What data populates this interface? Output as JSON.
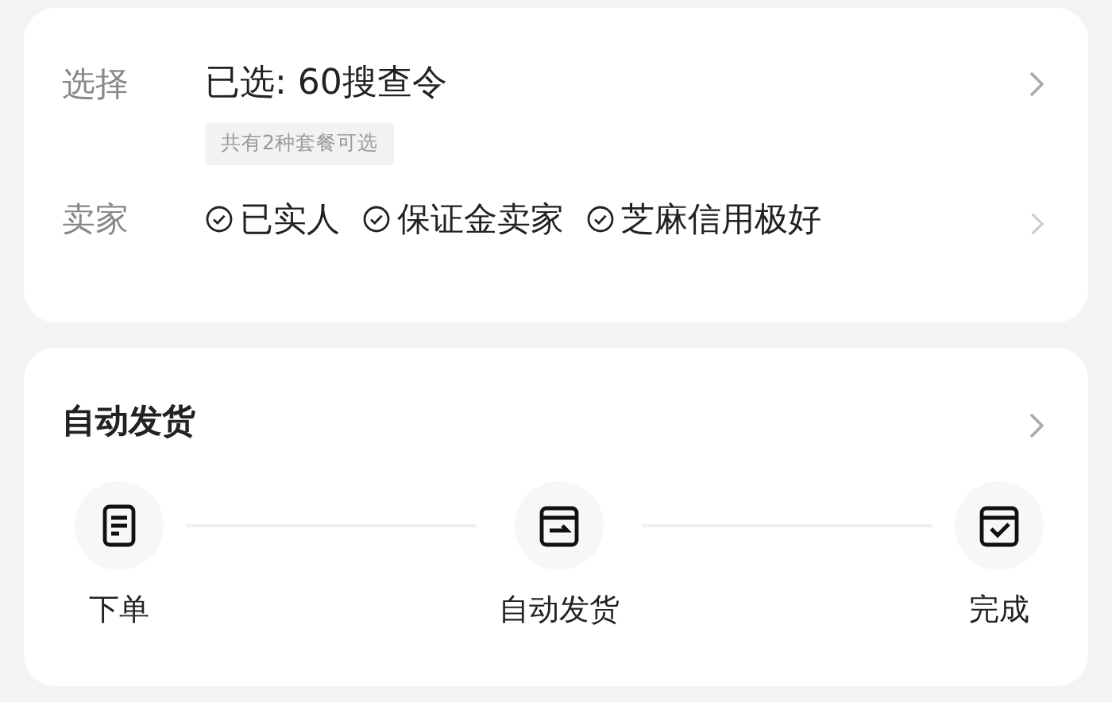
{
  "option": {
    "label": "选择",
    "value": "已选: 60搜查令",
    "hint": "共有2种套餐可选"
  },
  "seller": {
    "label": "卖家",
    "badges": [
      "已实人",
      "保证金卖家",
      "芝麻信用极好"
    ]
  },
  "delivery": {
    "title": "自动发货",
    "steps": [
      {
        "kind": "order",
        "label": "下单"
      },
      {
        "kind": "ship",
        "label": "自动发货"
      },
      {
        "kind": "done",
        "label": "完成"
      }
    ]
  }
}
